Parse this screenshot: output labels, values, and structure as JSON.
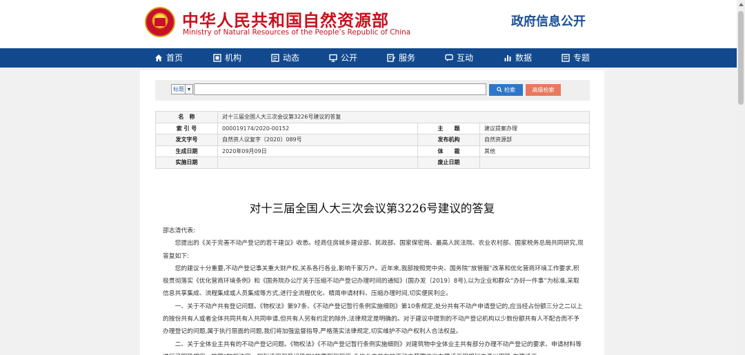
{
  "header": {
    "title": "中华人民共和国自然资源部",
    "subtitle": "Ministry of Natural Resources of the People’s Republic of China",
    "right_link": "政府信息公开"
  },
  "nav": [
    {
      "label": "首页",
      "icon": "home-icon"
    },
    {
      "label": "机构",
      "icon": "organization-icon"
    },
    {
      "label": "动态",
      "icon": "news-icon"
    },
    {
      "label": "公开",
      "icon": "monitor-icon"
    },
    {
      "label": "服务",
      "icon": "edit-icon"
    },
    {
      "label": "互动",
      "icon": "chat-icon"
    },
    {
      "label": "数据",
      "icon": "bar-chart-icon"
    },
    {
      "label": "专题",
      "icon": "topic-icon"
    }
  ],
  "search": {
    "select_value": "标题",
    "input_value": "",
    "search_button": "检索",
    "advanced_button": "高级检索"
  },
  "meta": {
    "name_key": "名　称",
    "name_val": "对十三届全国人大三次会议第3226号建议的答复",
    "index_key": "索 引 号",
    "index_val": "000019174/2020-00152",
    "topic_key": "主　　题",
    "topic_val": "建议提案办理",
    "docno_key": "发文字号",
    "docno_val": "自然资人议复字〔2020〕089号",
    "issuer_key": "发布机构",
    "issuer_val": "自然资源部",
    "date_key": "生成日期",
    "date_val": "2020年09月09日",
    "genre_key": "体　　裁",
    "genre_val": "其他",
    "effect_key": "实施日期",
    "effect_val": "",
    "abolish_key": "废止日期",
    "abolish_val": ""
  },
  "article": {
    "title": "对十三届全国人大三次会议第3226号建议的答复",
    "salutation": "邵志清代表:",
    "p1": "您提出的《关于完善不动产登记的若干建议》收悉。经商住房城乡建设部、民政部、国家保密局、最高人民法院、农业农村部、国家税务总局共同研究,现答复如下:",
    "p2": "您的建议十分重要,不动产登记事关重大财产权,关系各行各业,影响千家万户。近年来,我部按照党中央、国务院“放管服”改革和优化营商环境工作要求,积极贯彻落实《优化营商环境条例》和《国务院办公厅关于压缩不动产登记办理时间的通知》(国办发〔2019〕8号),以为企业和群众“办好一件事”为标准,采取信息共享集成、流程集成或人员集成等方式,进行全流程优化、精简申请材料、压缩办理时间,切实便民利企。",
    "p3": "一、关于不动产共有登记问题。《物权法》第97条、《不动产登记暂行条例实施细则》第10条规定,处分共有不动产申请登记的,应当经占份额三分之二以上的按份共有人或者全体共同共有人共同申请,但共有人另有约定的除外,法律规定是明确的。对于建议中提到的不动产登记机构以少数份额共有人不配合而不予办理登记的问题,属于执行层面的问题,我们将加强监督指导,严格落实法律规定,切实维护不动产权利人合法权益。",
    "p4": "二、关于全体业主共有的不动产登记问题。《物权法》《不动产登记暂行条例实施细则》对建筑物中全体业主共有部分办理不动产登记的要求、申请材料等进行了明确规定。按照“物权法定、权利设定和登记确权”的原则和程序,全体业主共有的不动产范围应当在建设工程规划中予以明确,在建设工"
  },
  "colors": {
    "brand_red": "#c8101e",
    "nav_blue": "#12498e",
    "search_blue": "#2f76c9",
    "advanced_orange": "#e8785e"
  }
}
